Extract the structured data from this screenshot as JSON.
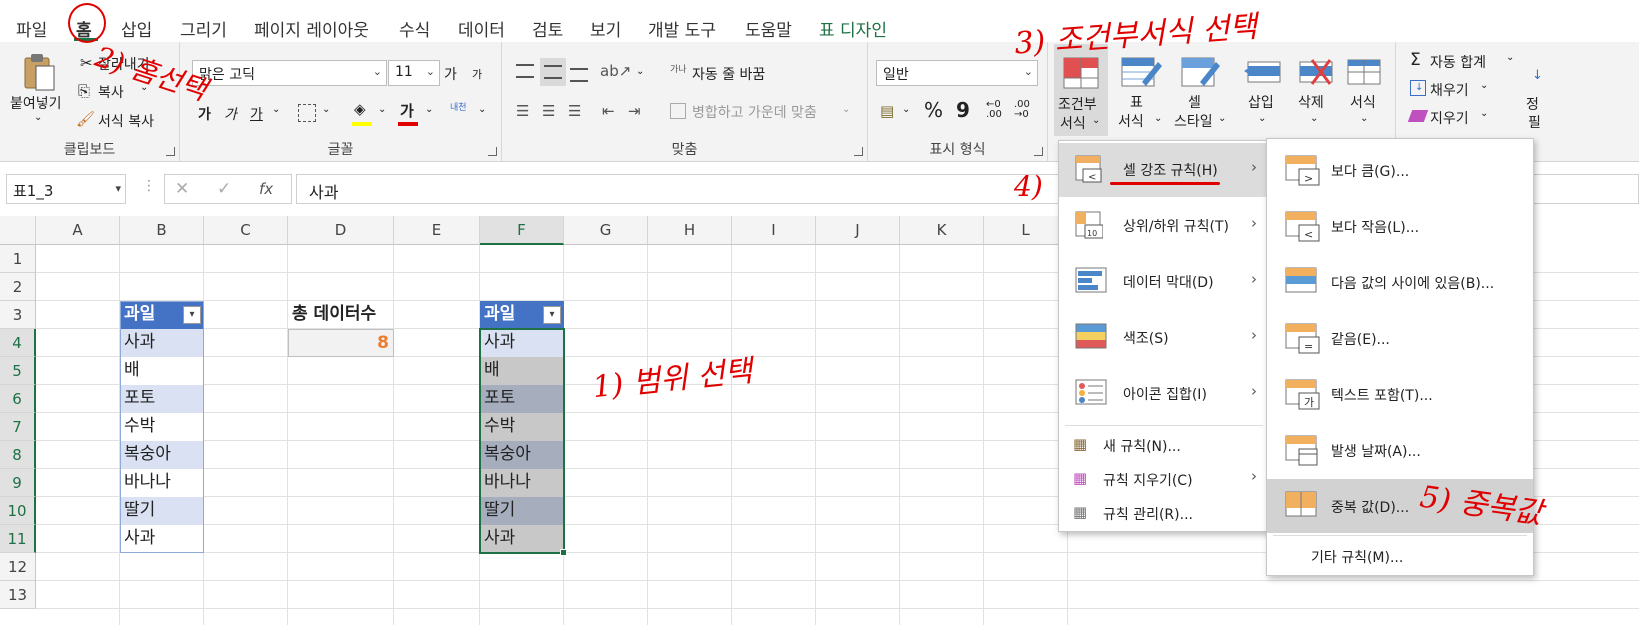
{
  "tabs": [
    "파일",
    "홈",
    "삽입",
    "그리기",
    "페이지 레이아웃",
    "수식",
    "데이터",
    "검토",
    "보기",
    "개발 도구",
    "도움말",
    "표 디자인"
  ],
  "clipboard": {
    "paste": "붙여넣기",
    "cut": "잘라내기",
    "copy": "복사",
    "format_painter": "서식 복사",
    "label": "클립보드"
  },
  "font": {
    "name": "맑은 고딕",
    "size": "11",
    "grow": "가",
    "shrink": "가",
    "bold": "가",
    "italic": "가",
    "underline": "가",
    "color_char": "가",
    "phonetic": "내천",
    "label": "글꼴",
    "accent_fill": "#ffff00",
    "accent_font": "#e00000"
  },
  "alignment": {
    "wrap": "자동 줄 바꿈",
    "merge": "병합하고 가운데 맞춤",
    "label": "맞춤",
    "wrap_icon": "가나"
  },
  "number": {
    "format": "일반",
    "label": "표시 형식",
    "percent": "%",
    "comma": "9"
  },
  "styles": {
    "conditional_line1": "조건부",
    "conditional_line2": "서식",
    "table_line1": "표",
    "table_line2": "서식",
    "cell_line1": "셀",
    "cell_line2": "스타일"
  },
  "cells_group": {
    "insert": "삽입",
    "delete": "삭제",
    "format": "서식"
  },
  "editing": {
    "autosum": "자동 합계",
    "fill": "채우기",
    "clear": "지우기",
    "sort_line1": "정",
    "sort_line2": "필"
  },
  "formula_bar": {
    "name_box": "표1_3",
    "fx": "fx",
    "value": "사과"
  },
  "columns": [
    "A",
    "B",
    "C",
    "D",
    "E",
    "F",
    "G",
    "H",
    "I",
    "J",
    "K",
    "L"
  ],
  "rows": [
    "1",
    "2",
    "3",
    "4",
    "5",
    "6",
    "7",
    "8",
    "9",
    "10",
    "11",
    "12",
    "13"
  ],
  "table_b": {
    "header": "과일",
    "items": [
      "사과",
      "배",
      "포토",
      "수박",
      "복숭아",
      "바나나",
      "딸기",
      "사과"
    ]
  },
  "table_f": {
    "header": "과일",
    "items": [
      "사과",
      "배",
      "포토",
      "수박",
      "복숭아",
      "바나나",
      "딸기",
      "사과"
    ]
  },
  "count": {
    "label": "총 데이터수",
    "value": "8",
    "value_color": "#ed7d31"
  },
  "menu_main": [
    {
      "label": "셀 강조 규칙(H)"
    },
    {
      "label": "상위/하위 규칙(T)"
    },
    {
      "label": "데이터 막대(D)"
    },
    {
      "label": "색조(S)"
    },
    {
      "label": "아이콘 집합(I)"
    },
    {
      "label": "새 규칙(N)..."
    },
    {
      "label": "규칙 지우기(C)"
    },
    {
      "label": "규칙 관리(R)..."
    }
  ],
  "menu_sub": [
    {
      "label": "보다 큼(G)...",
      "icon": ">"
    },
    {
      "label": "보다 작음(L)...",
      "icon": "<"
    },
    {
      "label": "다음 값의 사이에 있음(B)..."
    },
    {
      "label": "같음(E)...",
      "icon": "="
    },
    {
      "label": "텍스트 포함(T)...",
      "icon": "가"
    },
    {
      "label": "발생 날짜(A)..."
    },
    {
      "label": "중복 값(D)..."
    },
    {
      "label": "기타 규칙(M)..."
    }
  ],
  "annotations": {
    "n1": "1) 범위 선택",
    "n2": "2) 홈선택",
    "n3": "3) 조건부서식 선택",
    "n4": "4)",
    "n5": "5) 중복값"
  },
  "colors": {
    "table_header": "#4472c4",
    "band": "#d9e1f2",
    "selected_band": "#a6aebd",
    "selected_light": "#c8c8c8",
    "annotation": "#e00000"
  }
}
